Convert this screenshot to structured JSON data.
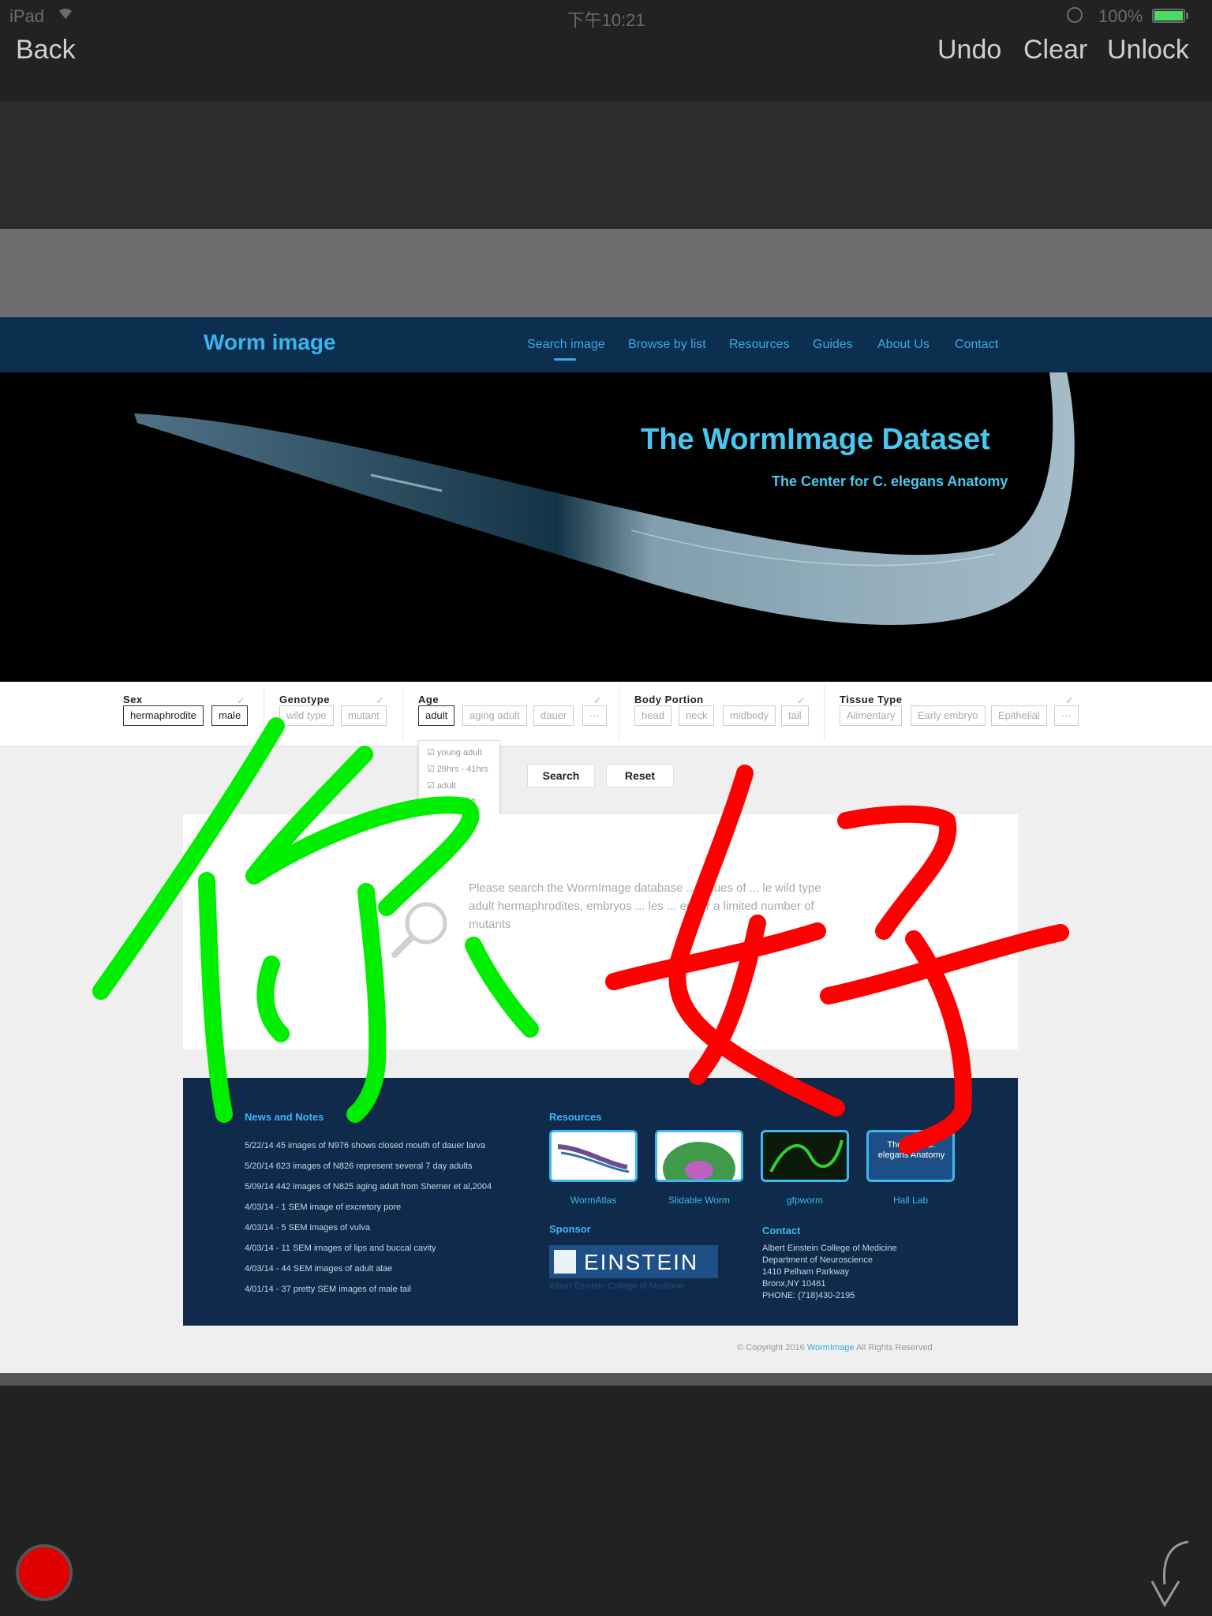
{
  "status_bar": {
    "carrier": "iPad",
    "time": "下午10:21",
    "battery_percent": "100%"
  },
  "toolbar": {
    "back_label": "Back",
    "undo_label": "Undo",
    "clear_label": "Clear",
    "unlock_label": "Unlock"
  },
  "site": {
    "logo_text": "Worm image",
    "nav": [
      "Search image",
      "Browse by list",
      "Resources",
      "Guides",
      "About Us",
      "Contact"
    ],
    "hero_title": "The WormImage Dataset",
    "hero_subtitle": "The Center for C. elegans Anatomy",
    "filters": {
      "sex": {
        "label": "Sex",
        "options": [
          "hermaphrodite",
          "male"
        ]
      },
      "genotype": {
        "label": "Genotype",
        "options": [
          "wild type",
          "mutant"
        ]
      },
      "age": {
        "label": "Age",
        "options": [
          "adult",
          "aging adult",
          "dauer",
          "···"
        ]
      },
      "body_portion": {
        "label": "Body Portion",
        "options": [
          "head",
          "neck",
          "midbody",
          "tail"
        ]
      },
      "tissue_type": {
        "label": "Tissue Type",
        "options": [
          "Alimentary",
          "Early embryo",
          "Epithelial",
          "···"
        ]
      }
    },
    "age_dropdown": [
      "young adult",
      "29hrs - 41hrs",
      "adult",
      "ult"
    ],
    "search_label": "Search",
    "reset_label": "Reset",
    "search_message": "Please search the WormImage database ... issues of ... le wild type adult hermaphrodites, embryos ... les ... ed for a limited number of mutants",
    "footer": {
      "news_heading": "News and Notes",
      "news": [
        "5/22/14 45 images of N976 shows closed mouth of dauer larva",
        "5/20/14 623 images of N826 represent several 7 day adults",
        "5/09/14 442 images of N825 aging adult from Shemer et al,2004",
        "4/03/14 - 1 SEM image of excretory pore",
        "4/03/14 - 5 SEM images of vulva",
        "4/03/14 - 11 SEM images of lips and buccal cavity",
        "4/03/14 - 44 SEM images of adult alae",
        "4/01/14 - 37 pretty SEM images of male tail"
      ],
      "resources_heading": "Resources",
      "resources": [
        "WormAtlas",
        "Slidable Worm",
        "gfpworm",
        "Hall Lab"
      ],
      "hall_tile_text": "The ... for C. elegans Anatomy",
      "sponsor_heading": "Sponsor",
      "sponsor_name": "EINSTEIN",
      "sponsor_sub": "Albert Einstein College of Medicine",
      "contact_heading": "Contact",
      "contact_lines": [
        "Albert Einstein College of Medicine",
        "Department of Neuroscience",
        "1410 Pelham Parkway",
        "Bronx,NY 10461",
        "PHONE: (718)430-2195"
      ]
    },
    "copyright_prefix": "© Copyright 2016",
    "copyright_brand": "WormImage",
    "copyright_suffix": "All Rights Reserved"
  },
  "ink": {
    "green_char": "你",
    "red_char": "好",
    "green_color": "#00ee00",
    "red_color": "#ff0000"
  },
  "colors": {
    "accent": "#3aa9e4",
    "nav_bg": "#0d2f4f",
    "pen_color": "#e00000"
  },
  "icons": {
    "color_picker": "red-circle-icon",
    "arrow": "curved-arrow-down-icon"
  }
}
